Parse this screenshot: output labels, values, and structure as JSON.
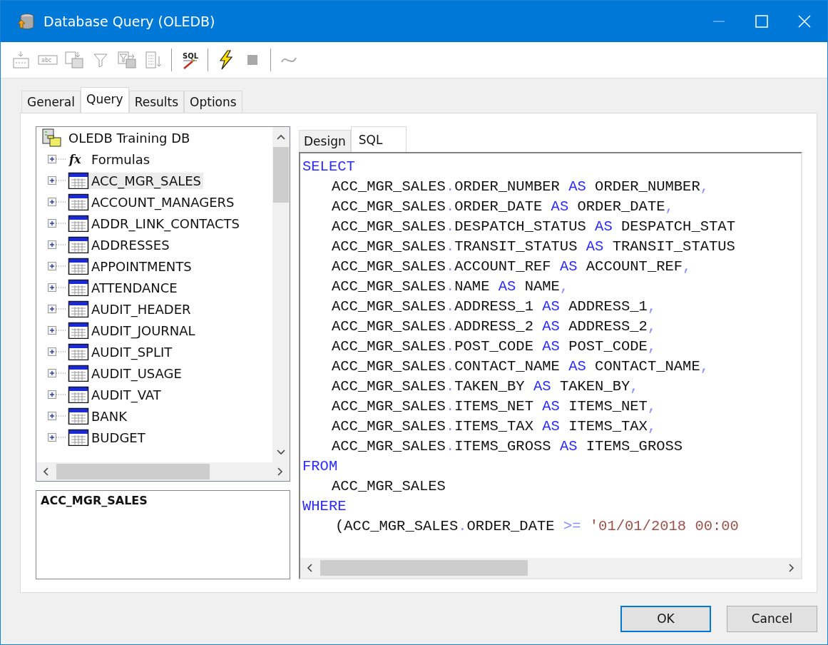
{
  "window": {
    "title": "Database Query (OLEDB)"
  },
  "toolbar": [
    {
      "kind": "insert-row",
      "disabled": true
    },
    {
      "kind": "text-field",
      "disabled": true,
      "text": "abc"
    },
    {
      "kind": "copy",
      "disabled": true
    },
    {
      "kind": "filter",
      "disabled": true
    },
    {
      "kind": "filter-copy",
      "disabled": true
    },
    {
      "kind": "list-down",
      "disabled": true
    },
    {
      "kind": "separator"
    },
    {
      "kind": "sql",
      "disabled": false,
      "text": "SQL"
    },
    {
      "kind": "separator"
    },
    {
      "kind": "lightning",
      "disabled": false
    },
    {
      "kind": "stop",
      "disabled": true
    },
    {
      "kind": "separator"
    },
    {
      "kind": "wave",
      "disabled": true
    }
  ],
  "tabs": [
    {
      "label": "General",
      "selected": false
    },
    {
      "label": "Query",
      "selected": true
    },
    {
      "label": "Results",
      "selected": false
    },
    {
      "label": "Options",
      "selected": false
    }
  ],
  "tree": {
    "root": {
      "label": "OLEDB Training DB",
      "children": [
        {
          "label": "Formulas",
          "kind": "formula",
          "icon_text": "fx",
          "selected": false,
          "expanded": false
        },
        {
          "label": "ACC_MGR_SALES",
          "kind": "table",
          "selected": true,
          "expanded": false
        },
        {
          "label": "ACCOUNT_MANAGERS",
          "kind": "table",
          "selected": false,
          "expanded": false
        },
        {
          "label": "ADDR_LINK_CONTACTS",
          "kind": "table",
          "selected": false,
          "expanded": false
        },
        {
          "label": "ADDRESSES",
          "kind": "table",
          "selected": false,
          "expanded": false
        },
        {
          "label": "APPOINTMENTS",
          "kind": "table",
          "selected": false,
          "expanded": false
        },
        {
          "label": "ATTENDANCE",
          "kind": "table",
          "selected": false,
          "expanded": false
        },
        {
          "label": "AUDIT_HEADER",
          "kind": "table",
          "selected": false,
          "expanded": false
        },
        {
          "label": "AUDIT_JOURNAL",
          "kind": "table",
          "selected": false,
          "expanded": false
        },
        {
          "label": "AUDIT_SPLIT",
          "kind": "table",
          "selected": false,
          "expanded": false
        },
        {
          "label": "AUDIT_USAGE",
          "kind": "table",
          "selected": false,
          "expanded": false
        },
        {
          "label": "AUDIT_VAT",
          "kind": "table",
          "selected": false,
          "expanded": false
        },
        {
          "label": "BANK",
          "kind": "table",
          "selected": false,
          "expanded": false
        },
        {
          "label": "BUDGET",
          "kind": "table",
          "selected": false,
          "expanded": false
        }
      ]
    }
  },
  "description": {
    "title": "ACC_MGR_SALES"
  },
  "editor_tabs": [
    {
      "label": "Design",
      "selected": false
    },
    {
      "label": "SQL",
      "selected": true
    }
  ],
  "sql_lines": [
    {
      "kind": "clause",
      "tokens": [
        {
          "kind": "keyword",
          "text": "SELECT"
        }
      ]
    },
    {
      "kind": "item",
      "tokens": [
        {
          "kind": "ident",
          "text": "ACC_MGR_SALES"
        },
        {
          "kind": "punct",
          "text": "."
        },
        {
          "kind": "ident",
          "text": "ORDER_NUMBER "
        },
        {
          "kind": "keyword",
          "text": "AS"
        },
        {
          "kind": "ident",
          "text": " ORDER_NUMBER"
        },
        {
          "kind": "punct",
          "text": ","
        }
      ]
    },
    {
      "kind": "item",
      "tokens": [
        {
          "kind": "ident",
          "text": "ACC_MGR_SALES"
        },
        {
          "kind": "punct",
          "text": "."
        },
        {
          "kind": "ident",
          "text": "ORDER_DATE "
        },
        {
          "kind": "keyword",
          "text": "AS"
        },
        {
          "kind": "ident",
          "text": " ORDER_DATE"
        },
        {
          "kind": "punct",
          "text": ","
        }
      ]
    },
    {
      "kind": "item",
      "tokens": [
        {
          "kind": "ident",
          "text": "ACC_MGR_SALES"
        },
        {
          "kind": "punct",
          "text": "."
        },
        {
          "kind": "ident",
          "text": "DESPATCH_STATUS "
        },
        {
          "kind": "keyword",
          "text": "AS"
        },
        {
          "kind": "ident",
          "text": " DESPATCH_STAT"
        }
      ]
    },
    {
      "kind": "item",
      "tokens": [
        {
          "kind": "ident",
          "text": "ACC_MGR_SALES"
        },
        {
          "kind": "punct",
          "text": "."
        },
        {
          "kind": "ident",
          "text": "TRANSIT_STATUS "
        },
        {
          "kind": "keyword",
          "text": "AS"
        },
        {
          "kind": "ident",
          "text": " TRANSIT_STATUS"
        }
      ]
    },
    {
      "kind": "item",
      "tokens": [
        {
          "kind": "ident",
          "text": "ACC_MGR_SALES"
        },
        {
          "kind": "punct",
          "text": "."
        },
        {
          "kind": "ident",
          "text": "ACCOUNT_REF "
        },
        {
          "kind": "keyword",
          "text": "AS"
        },
        {
          "kind": "ident",
          "text": " ACCOUNT_REF"
        },
        {
          "kind": "punct",
          "text": ","
        }
      ]
    },
    {
      "kind": "item",
      "tokens": [
        {
          "kind": "ident",
          "text": "ACC_MGR_SALES"
        },
        {
          "kind": "punct",
          "text": "."
        },
        {
          "kind": "ident",
          "text": "NAME "
        },
        {
          "kind": "keyword",
          "text": "AS"
        },
        {
          "kind": "ident",
          "text": " NAME"
        },
        {
          "kind": "punct",
          "text": ","
        }
      ]
    },
    {
      "kind": "item",
      "tokens": [
        {
          "kind": "ident",
          "text": "ACC_MGR_SALES"
        },
        {
          "kind": "punct",
          "text": "."
        },
        {
          "kind": "ident",
          "text": "ADDRESS_1 "
        },
        {
          "kind": "keyword",
          "text": "AS"
        },
        {
          "kind": "ident",
          "text": " ADDRESS_1"
        },
        {
          "kind": "punct",
          "text": ","
        }
      ]
    },
    {
      "kind": "item",
      "tokens": [
        {
          "kind": "ident",
          "text": "ACC_MGR_SALES"
        },
        {
          "kind": "punct",
          "text": "."
        },
        {
          "kind": "ident",
          "text": "ADDRESS_2 "
        },
        {
          "kind": "keyword",
          "text": "AS"
        },
        {
          "kind": "ident",
          "text": " ADDRESS_2"
        },
        {
          "kind": "punct",
          "text": ","
        }
      ]
    },
    {
      "kind": "item",
      "tokens": [
        {
          "kind": "ident",
          "text": "ACC_MGR_SALES"
        },
        {
          "kind": "punct",
          "text": "."
        },
        {
          "kind": "ident",
          "text": "POST_CODE "
        },
        {
          "kind": "keyword",
          "text": "AS"
        },
        {
          "kind": "ident",
          "text": " POST_CODE"
        },
        {
          "kind": "punct",
          "text": ","
        }
      ]
    },
    {
      "kind": "item",
      "tokens": [
        {
          "kind": "ident",
          "text": "ACC_MGR_SALES"
        },
        {
          "kind": "punct",
          "text": "."
        },
        {
          "kind": "ident",
          "text": "CONTACT_NAME "
        },
        {
          "kind": "keyword",
          "text": "AS"
        },
        {
          "kind": "ident",
          "text": " CONTACT_NAME"
        },
        {
          "kind": "punct",
          "text": ","
        }
      ]
    },
    {
      "kind": "item",
      "tokens": [
        {
          "kind": "ident",
          "text": "ACC_MGR_SALES"
        },
        {
          "kind": "punct",
          "text": "."
        },
        {
          "kind": "ident",
          "text": "TAKEN_BY "
        },
        {
          "kind": "keyword",
          "text": "AS"
        },
        {
          "kind": "ident",
          "text": " TAKEN_BY"
        },
        {
          "kind": "punct",
          "text": ","
        }
      ]
    },
    {
      "kind": "item",
      "tokens": [
        {
          "kind": "ident",
          "text": "ACC_MGR_SALES"
        },
        {
          "kind": "punct",
          "text": "."
        },
        {
          "kind": "ident",
          "text": "ITEMS_NET "
        },
        {
          "kind": "keyword",
          "text": "AS"
        },
        {
          "kind": "ident",
          "text": " ITEMS_NET"
        },
        {
          "kind": "punct",
          "text": ","
        }
      ]
    },
    {
      "kind": "item",
      "tokens": [
        {
          "kind": "ident",
          "text": "ACC_MGR_SALES"
        },
        {
          "kind": "punct",
          "text": "."
        },
        {
          "kind": "ident",
          "text": "ITEMS_TAX "
        },
        {
          "kind": "keyword",
          "text": "AS"
        },
        {
          "kind": "ident",
          "text": " ITEMS_TAX"
        },
        {
          "kind": "punct",
          "text": ","
        }
      ]
    },
    {
      "kind": "item",
      "tokens": [
        {
          "kind": "ident",
          "text": "ACC_MGR_SALES"
        },
        {
          "kind": "punct",
          "text": "."
        },
        {
          "kind": "ident",
          "text": "ITEMS_GROSS "
        },
        {
          "kind": "keyword",
          "text": "AS"
        },
        {
          "kind": "ident",
          "text": " ITEMS_GROSS"
        }
      ]
    },
    {
      "kind": "clause",
      "tokens": [
        {
          "kind": "keyword",
          "text": "FROM"
        }
      ]
    },
    {
      "kind": "item",
      "tokens": [
        {
          "kind": "ident",
          "text": "ACC_MGR_SALES"
        }
      ]
    },
    {
      "kind": "clause",
      "tokens": [
        {
          "kind": "keyword",
          "text": "WHERE"
        }
      ]
    },
    {
      "kind": "condition",
      "tokens": [
        {
          "kind": "ident",
          "text": "(ACC_MGR_SALES"
        },
        {
          "kind": "punct",
          "text": "."
        },
        {
          "kind": "ident",
          "text": "ORDER_DATE "
        },
        {
          "kind": "punct",
          "text": ">="
        },
        {
          "kind": "string",
          "text": " '01/01/2018 00:00"
        }
      ]
    }
  ],
  "buttons": [
    {
      "label": "OK",
      "default": true
    },
    {
      "label": "Cancel",
      "default": false
    }
  ]
}
